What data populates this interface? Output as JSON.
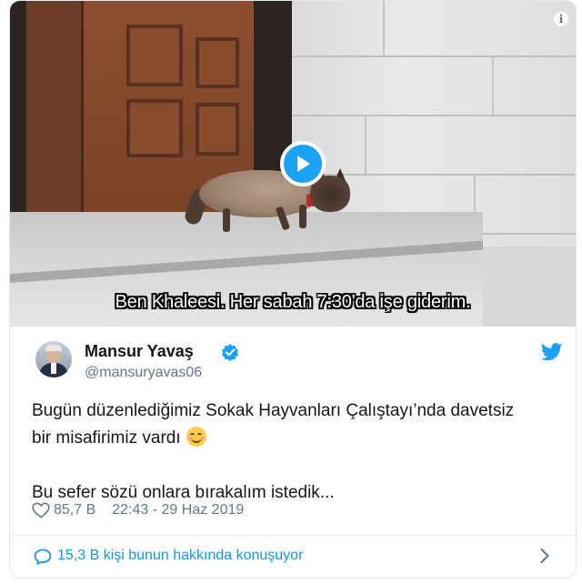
{
  "video": {
    "subtitle": "Ben Khaleesi. Her sabah 7:30'da işe giderim."
  },
  "tweet": {
    "author_name": "Mansur Yavaş",
    "author_handle": "@mansuryavas06",
    "verified": true,
    "text_line1": "Bugün düzenlediğimiz Sokak Hayvanları Çalıştayı’nda davetsiz",
    "text_line2": "bir misafirimiz vardı",
    "text_line3": "Bu sefer sözü onlara bırakalım istedik...",
    "likes": "85,7 B",
    "timestamp": "22:43 - 29 Haz 2019",
    "conversation": "15,3 B kişi bunun hakkında konuşuyor"
  },
  "icons": {
    "play": "play-icon",
    "info": "info-icon",
    "verified": "verified-badge-icon",
    "twitter": "twitter-bird-icon",
    "like": "heart-icon",
    "reply": "speech-bubble-icon",
    "chevron": "chevron-right-icon",
    "emoji": "smiling-face-with-smiling-eyes-emoji"
  },
  "colors": {
    "brand_blue": "#1da1f2",
    "link_blue": "#1b95e0",
    "secondary_text": "#657786",
    "primary_text": "#14171a"
  }
}
